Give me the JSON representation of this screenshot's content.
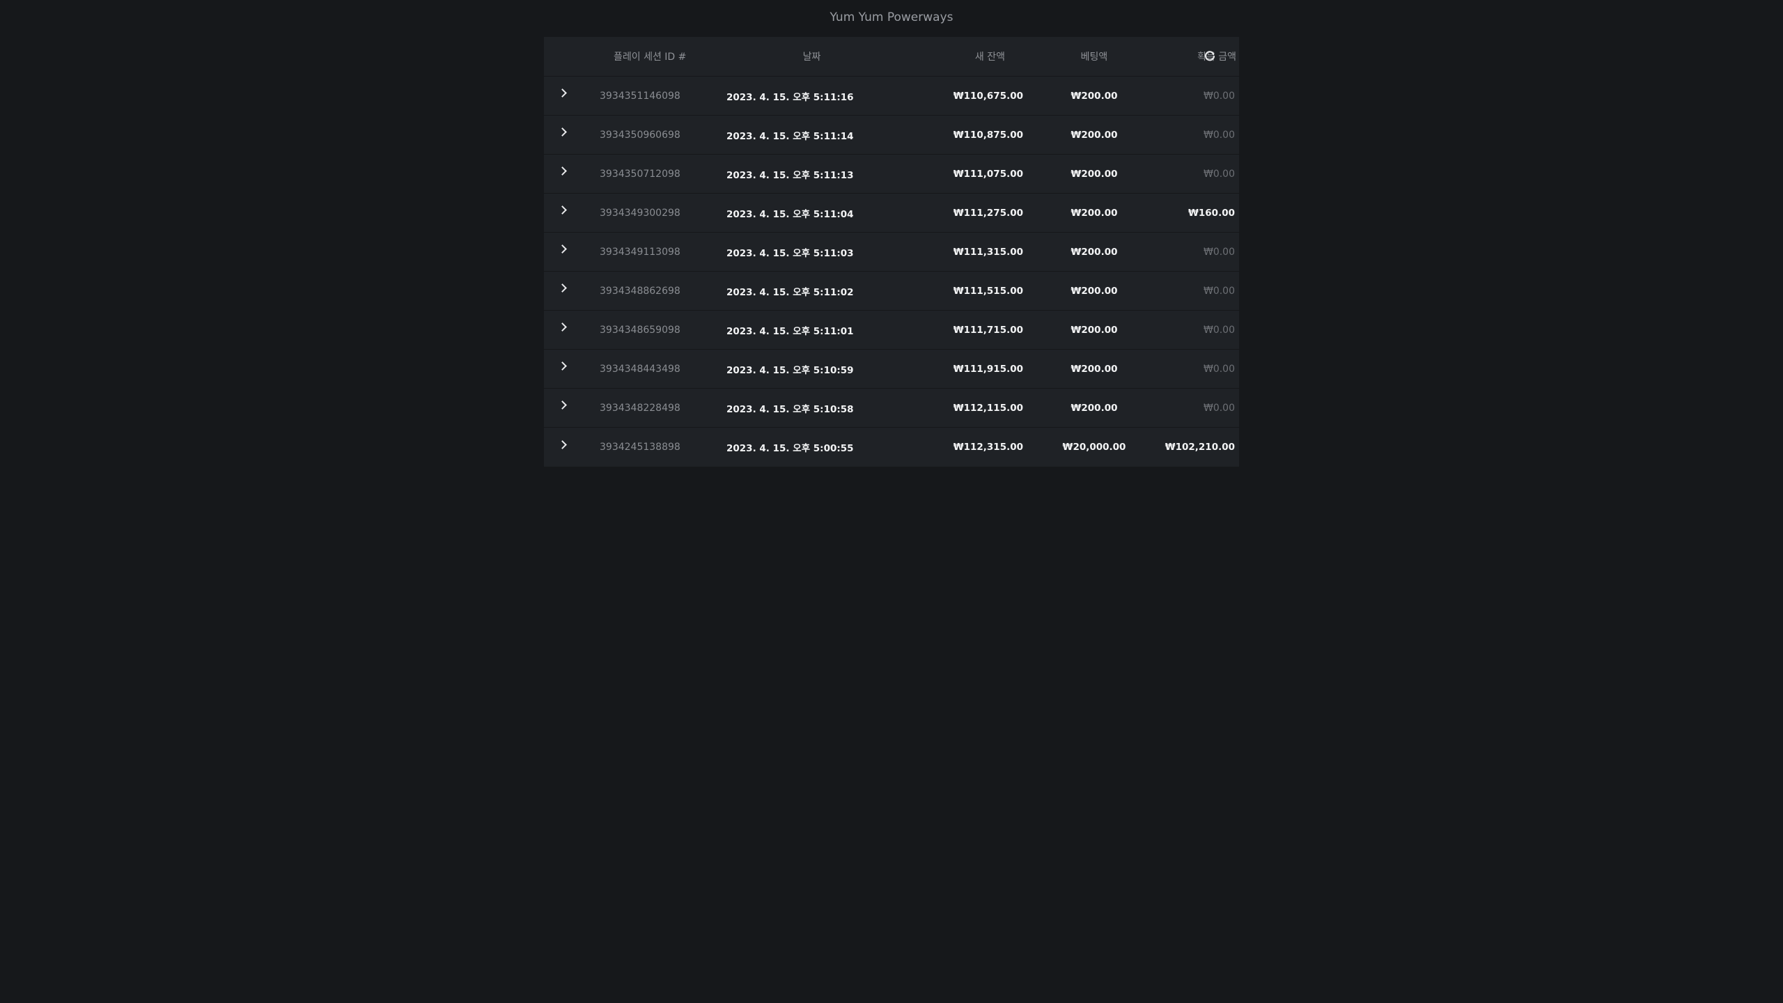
{
  "app": {
    "title": "Yum Yum Powerways"
  },
  "table": {
    "headers": {
      "id": "플레이 세션 ID #",
      "date": "날짜",
      "balance": "새 잔액",
      "bet": "베팅액",
      "win": "획득 금액"
    },
    "refresh_icon": "refresh-icon",
    "rows": [
      {
        "id": "3934351146098",
        "date": "2023. 4. 15. 오후 5:11:16",
        "balance": "₩110,675.00",
        "bet": "₩200.00",
        "win": "₩0.00",
        "win_nonzero": false
      },
      {
        "id": "3934350960698",
        "date": "2023. 4. 15. 오후 5:11:14",
        "balance": "₩110,875.00",
        "bet": "₩200.00",
        "win": "₩0.00",
        "win_nonzero": false
      },
      {
        "id": "3934350712098",
        "date": "2023. 4. 15. 오후 5:11:13",
        "balance": "₩111,075.00",
        "bet": "₩200.00",
        "win": "₩0.00",
        "win_nonzero": false
      },
      {
        "id": "3934349300298",
        "date": "2023. 4. 15. 오후 5:11:04",
        "balance": "₩111,275.00",
        "bet": "₩200.00",
        "win": "₩160.00",
        "win_nonzero": true
      },
      {
        "id": "3934349113098",
        "date": "2023. 4. 15. 오후 5:11:03",
        "balance": "₩111,315.00",
        "bet": "₩200.00",
        "win": "₩0.00",
        "win_nonzero": false
      },
      {
        "id": "3934348862698",
        "date": "2023. 4. 15. 오후 5:11:02",
        "balance": "₩111,515.00",
        "bet": "₩200.00",
        "win": "₩0.00",
        "win_nonzero": false
      },
      {
        "id": "3934348659098",
        "date": "2023. 4. 15. 오후 5:11:01",
        "balance": "₩111,715.00",
        "bet": "₩200.00",
        "win": "₩0.00",
        "win_nonzero": false
      },
      {
        "id": "3934348443498",
        "date": "2023. 4. 15. 오후 5:10:59",
        "balance": "₩111,915.00",
        "bet": "₩200.00",
        "win": "₩0.00",
        "win_nonzero": false
      },
      {
        "id": "3934348228498",
        "date": "2023. 4. 15. 오후 5:10:58",
        "balance": "₩112,115.00",
        "bet": "₩200.00",
        "win": "₩0.00",
        "win_nonzero": false
      },
      {
        "id": "3934245138898",
        "date": "2023. 4. 15. 오후 5:00:55",
        "balance": "₩112,315.00",
        "bet": "₩20,000.00",
        "win": "₩102,210.00",
        "win_nonzero": true
      }
    ]
  },
  "colors": {
    "background": "#16181b",
    "table_bg": "#1f2226",
    "text_strong": "#f3f4f5",
    "text_muted": "#6d7075",
    "text_id": "#8a8d92"
  }
}
